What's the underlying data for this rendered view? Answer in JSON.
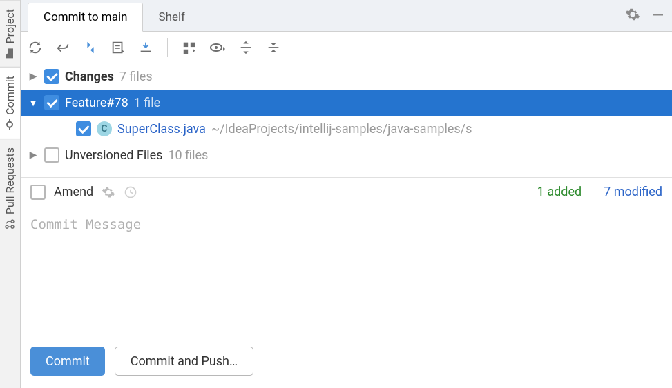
{
  "sidebar": {
    "items": [
      {
        "label": "Project"
      },
      {
        "label": "Commit"
      },
      {
        "label": "Pull Requests"
      }
    ]
  },
  "tabs": {
    "items": [
      {
        "label": "Commit to main"
      },
      {
        "label": "Shelf"
      }
    ]
  },
  "tree": {
    "changes": {
      "label": "Changes",
      "count": "7 files"
    },
    "feature": {
      "label": "Feature#78",
      "count": "1 file"
    },
    "file": {
      "name": "SuperClass.java",
      "path": "~/IdeaProjects/intellij-samples/java-samples/s"
    },
    "unversioned": {
      "label": "Unversioned Files",
      "count": "10 files"
    }
  },
  "amend": {
    "label": "Amend"
  },
  "stats": {
    "added": "1 added",
    "modified": "7 modified"
  },
  "message": {
    "placeholder": "Commit Message"
  },
  "buttons": {
    "commit": "Commit",
    "commitPush": "Commit and Push…"
  }
}
